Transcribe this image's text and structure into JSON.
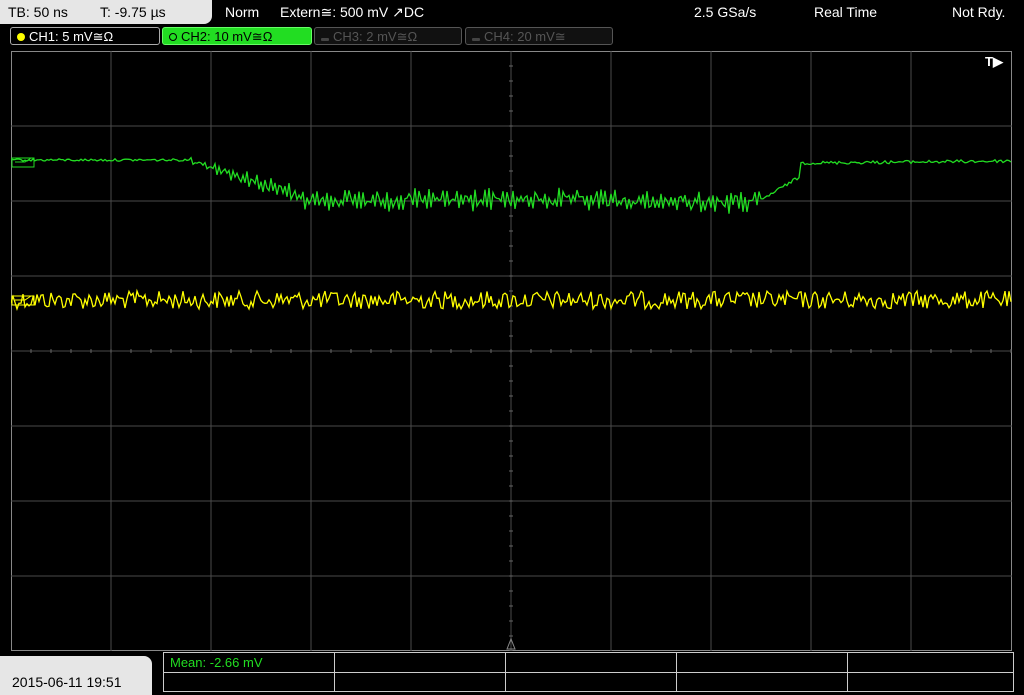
{
  "status": {
    "timebase": "TB: 50 ns",
    "trigger_offset": "T: -9.75 µs",
    "mode": "Norm",
    "trigger_source": "Extern≅: 500 mV ↗DC",
    "sample_rate": "2.5 GSa/s",
    "acquisition": "Real Time",
    "ready_state": "Not Rdy."
  },
  "channels": [
    {
      "label": "CH1: 5 mV≅Ω",
      "color": "#ffff00",
      "active": true
    },
    {
      "label": "CH2: 10 mV≅Ω",
      "color": "#22dd22",
      "active": true
    },
    {
      "label": "CH3: 2 mV≅Ω",
      "color": "#444444",
      "active": false
    },
    {
      "label": "CH4: 20 mV≅",
      "color": "#444444",
      "active": false
    }
  ],
  "trigger_marker": "T▶",
  "measurement": {
    "mean": "Mean: -2.66 mV"
  },
  "datetime": "2015-06-11 19:51",
  "colors": {
    "ch1": "#ffff00",
    "ch2": "#22dd22",
    "grid": "#555555"
  }
}
